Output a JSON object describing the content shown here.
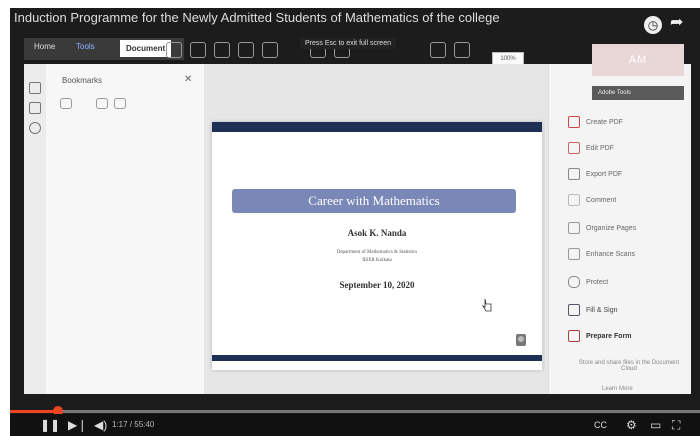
{
  "video": {
    "title": "Induction Programme for the Newly Admitted Students of Mathematics of the college",
    "time": "1:17 / 55:40",
    "progress": 0.07,
    "colors": {
      "progress": "#e42"
    }
  },
  "acrobat": {
    "tabs": [
      "Home",
      "Tools",
      "Document"
    ],
    "esc_hint": "Press Esc to exit full screen",
    "zoom": "100%",
    "avatar_initials": "AM",
    "bookmarks_title": "Bookmarks",
    "panel_header": "Adobe Tools",
    "tools": [
      "Create PDF",
      "Edit PDF",
      "Export PDF",
      "Comment",
      "Organize Pages",
      "Enhance Scans",
      "Protect",
      "Fill & Sign",
      "Prepare Form"
    ],
    "more_tools_text": "Store and share files in the Document Cloud",
    "learn_more": "Learn More"
  },
  "slide": {
    "title": "Career with Mathematics",
    "author": "Asok K. Nanda",
    "department": "Department of Mathematics & Statistics",
    "institute": "IISER Kolkata",
    "date": "September 10, 2020"
  },
  "icons": [
    "watch-later-icon",
    "share-icon",
    "play-icon",
    "next-icon",
    "volume-icon",
    "settings-icon",
    "fullscreen-icon"
  ]
}
